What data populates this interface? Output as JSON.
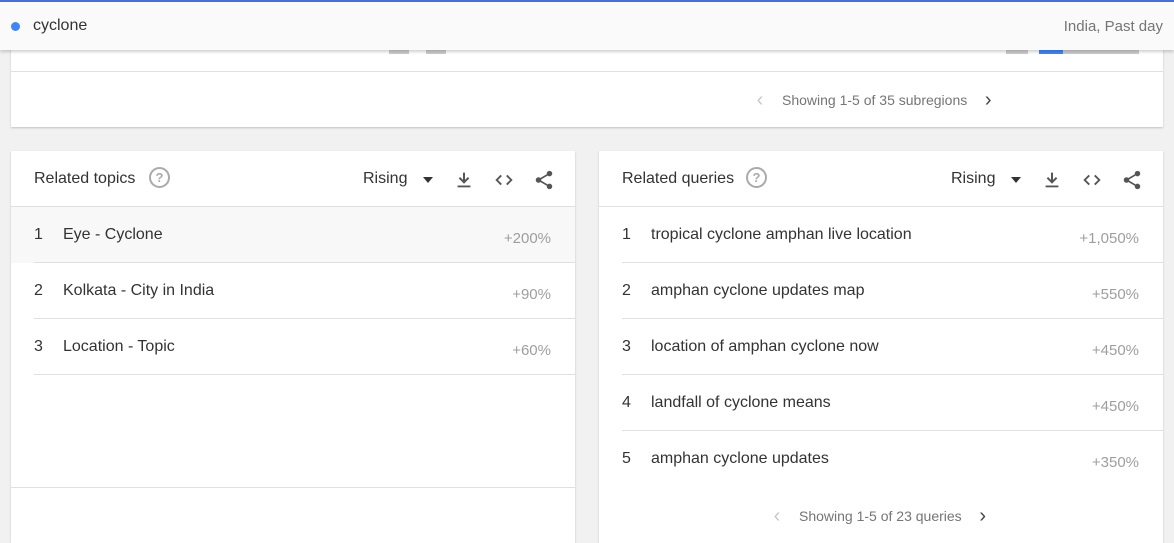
{
  "search": {
    "term": "cyclone",
    "scope": "India, Past day"
  },
  "map_panel": {
    "pagination": "Showing 1-5 of 35 subregions"
  },
  "related_topics": {
    "title": "Related topics",
    "help": "?",
    "sort": "Rising",
    "items": [
      {
        "rank": "1",
        "label": "Eye - Cyclone",
        "value": "+200%"
      },
      {
        "rank": "2",
        "label": "Kolkata - City in India",
        "value": "+90%"
      },
      {
        "rank": "3",
        "label": "Location - Topic",
        "value": "+60%"
      }
    ]
  },
  "related_queries": {
    "title": "Related queries",
    "help": "?",
    "sort": "Rising",
    "items": [
      {
        "rank": "1",
        "label": "tropical cyclone amphan live location",
        "value": "+1,050%"
      },
      {
        "rank": "2",
        "label": "amphan cyclone updates map",
        "value": "+550%"
      },
      {
        "rank": "3",
        "label": "location of amphan cyclone now",
        "value": "+450%"
      },
      {
        "rank": "4",
        "label": "landfall of cyclone means",
        "value": "+450%"
      },
      {
        "rank": "5",
        "label": "amphan cyclone updates",
        "value": "+350%"
      }
    ],
    "pagination": "Showing 1-5 of 23 queries"
  },
  "icons": {
    "prev": "chevron-left-icon",
    "next": "chevron-right-icon",
    "download": "download-icon",
    "embed": "embed-code-icon",
    "share": "share-icon",
    "help": "help-circle-icon"
  },
  "colors": {
    "accent": "#4285f4",
    "value_text": "#9e9e9e"
  }
}
